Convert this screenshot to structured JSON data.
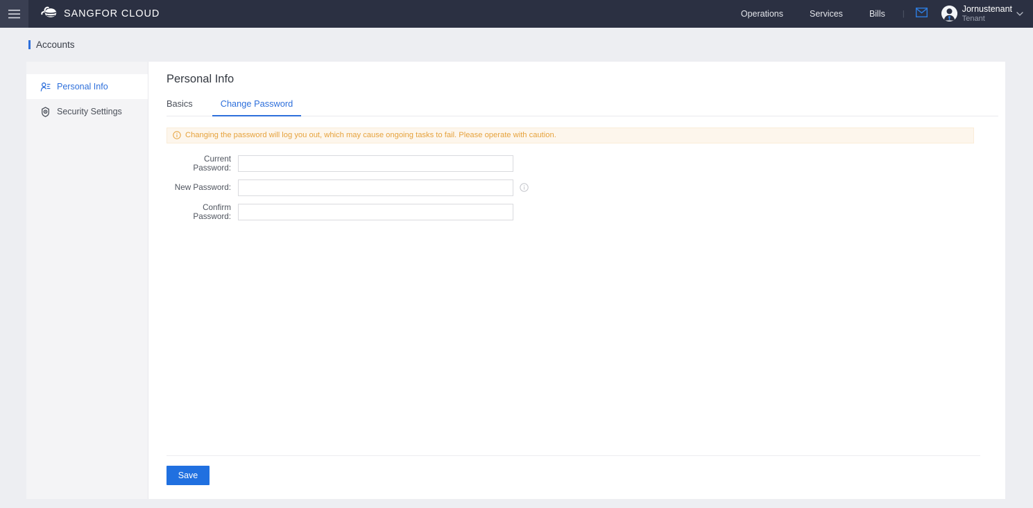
{
  "header": {
    "menu_icon": "hamburger-icon",
    "brand_icon": "cloud-logo-icon",
    "brand": "SANGFOR CLOUD",
    "nav": [
      {
        "label": "Operations"
      },
      {
        "label": "Services"
      },
      {
        "label": "Bills"
      }
    ],
    "separator": "|",
    "mail_icon": "envelope-icon",
    "user": {
      "avatar_icon": "user-avatar-icon",
      "name": "Jornustenant",
      "role": "Tenant",
      "caret_icon": "chevron-down-icon"
    },
    "background": "#2b3042"
  },
  "breadcrumb": {
    "label": "Accounts",
    "accent": "#2d6fdb"
  },
  "sidebar": {
    "items": [
      {
        "label": "Personal Info",
        "icon": "user-profile-icon",
        "active": true
      },
      {
        "label": "Security Settings",
        "icon": "shield-gear-icon",
        "active": false
      }
    ]
  },
  "main": {
    "title": "Personal Info",
    "tabs": [
      {
        "label": "Basics",
        "active": false
      },
      {
        "label": "Change Password",
        "active": true
      }
    ],
    "alert": {
      "icon": "info-circle-icon",
      "text": "Changing the password will log you out, which may cause ongoing tasks to fail. Please operate with caution.",
      "color": "#e6a23c",
      "background": "#fdf6ec"
    },
    "form": {
      "fields": [
        {
          "label": "Current Password:",
          "value": "",
          "placeholder": "",
          "hint": false
        },
        {
          "label": "New Password:",
          "value": "",
          "placeholder": "",
          "hint": true,
          "hint_icon": "info-circle-icon"
        },
        {
          "label": "Confirm Password:",
          "value": "",
          "placeholder": "",
          "hint": false
        }
      ]
    },
    "save_label": "Save",
    "save_color": "#2070e0"
  }
}
